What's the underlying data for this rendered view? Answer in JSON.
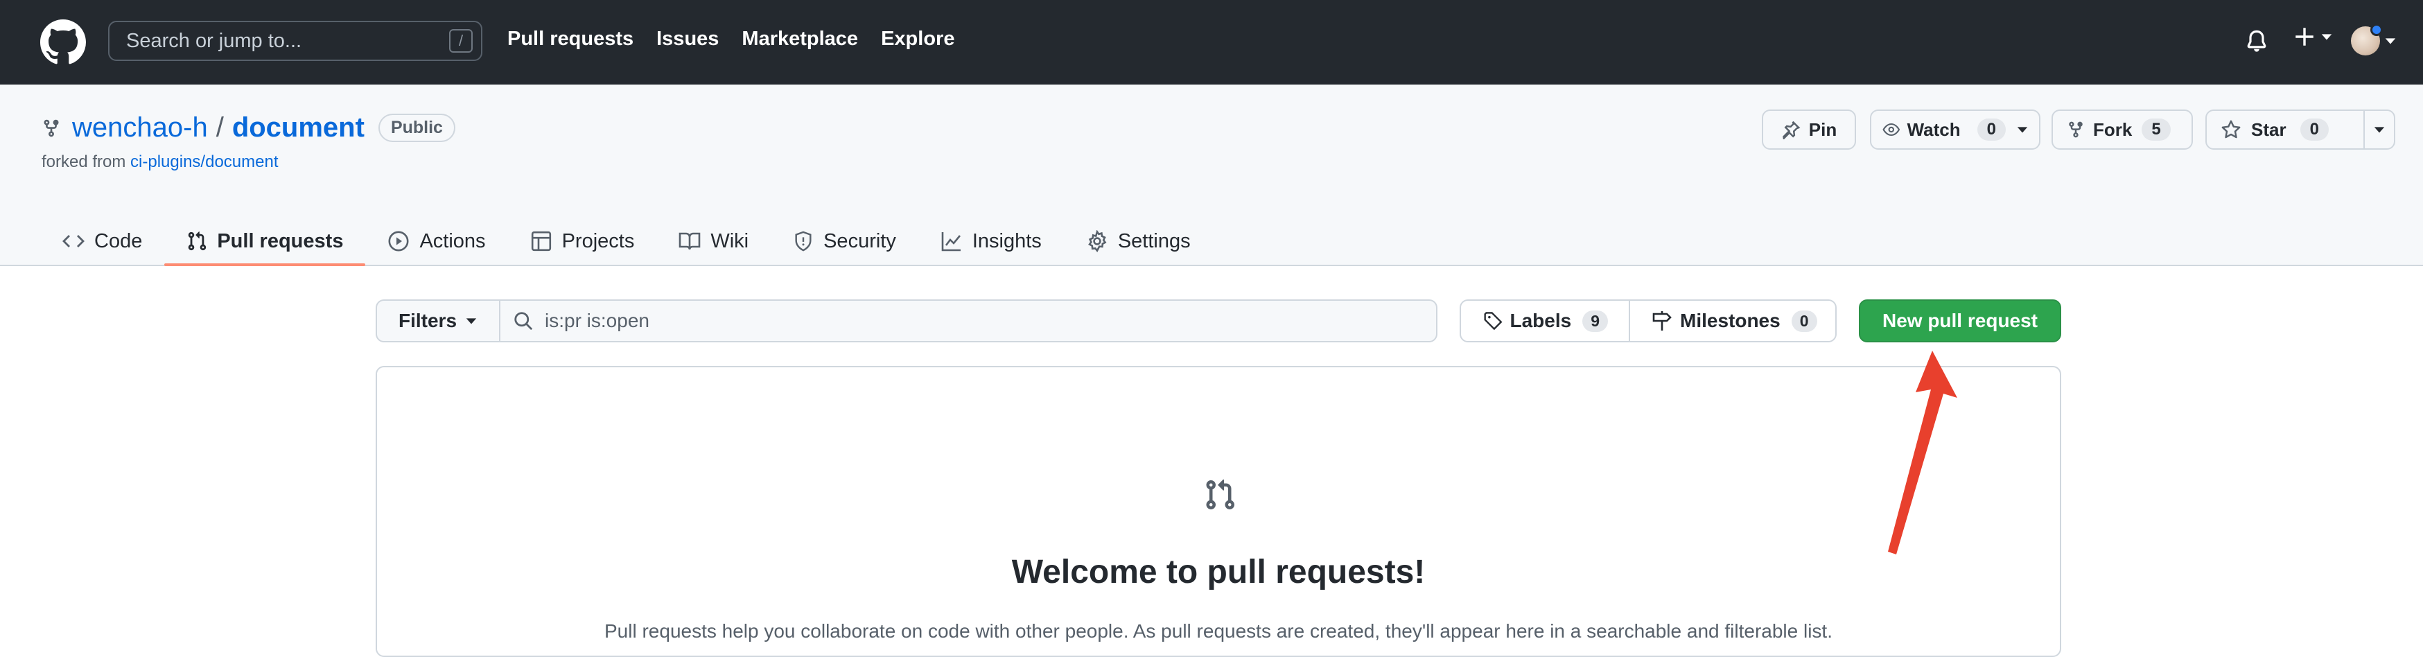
{
  "header": {
    "search_placeholder": "Search or jump to...",
    "search_shortcut": "/",
    "nav": [
      "Pull requests",
      "Issues",
      "Marketplace",
      "Explore"
    ]
  },
  "repo": {
    "owner": "wenchao-h",
    "separator": "/",
    "name": "document",
    "visibility": "Public",
    "forked_prefix": "forked from",
    "forked_source": "ci-plugins/document",
    "actions": {
      "pin": "Pin",
      "watch": "Watch",
      "watch_count": "0",
      "fork": "Fork",
      "fork_count": "5",
      "star": "Star",
      "star_count": "0"
    },
    "tabs": [
      "Code",
      "Pull requests",
      "Actions",
      "Projects",
      "Wiki",
      "Security",
      "Insights",
      "Settings"
    ],
    "active_tab": "Pull requests"
  },
  "toolbar": {
    "filters": "Filters",
    "search_value": "is:pr is:open",
    "labels": "Labels",
    "labels_count": "9",
    "milestones": "Milestones",
    "milestones_count": "0",
    "new_pr": "New pull request"
  },
  "blankslate": {
    "title": "Welcome to pull requests!",
    "description": "Pull requests help you collaborate on code with other people. As pull requests are created, they'll appear here in a searchable and filterable list."
  },
  "colors": {
    "header_bg": "#24292f",
    "accent_link": "#0969da",
    "primary_button": "#2da44e",
    "active_tab_underline": "#fd8c73",
    "annotation_arrow": "#e8402d"
  }
}
